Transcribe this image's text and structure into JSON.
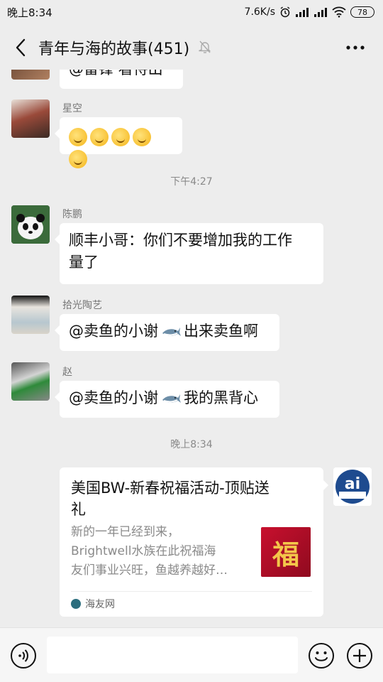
{
  "status": {
    "time": "晚上8:34",
    "speed": "7.6K/s",
    "battery": "78"
  },
  "header": {
    "title": "青年与海的故事(451)"
  },
  "messages": [
    {
      "sender": "",
      "text": "@雷锋  看待出",
      "partial": true
    },
    {
      "sender": "星空",
      "emoji_count": 5
    },
    {
      "timestamp": "下午4:27"
    },
    {
      "sender": "陈鹏",
      "text_line1": "顺丰小哥：你们不要增加我的工作",
      "text_line2": "量了"
    },
    {
      "sender": "拾光陶艺",
      "text_before": "@卖鱼的小谢",
      "text_after": "出来卖鱼啊"
    },
    {
      "sender": "赵",
      "text_before": "@卖鱼的小谢",
      "text_after": "我的黑背心"
    },
    {
      "timestamp": "晚上8:34"
    }
  ],
  "card": {
    "title_line1": "美国BW-新春祝福活动-顶贴送",
    "title_line2": "礼",
    "desc_line1": "新的一年已经到来，",
    "desc_line2": "Brightwell水族在此祝福海",
    "desc_line3": "友们事业兴旺，鱼越养越好…",
    "source": "海友网",
    "thumb_char": "福"
  },
  "colors": {
    "background": "#ededed",
    "bubble": "#ffffff",
    "card_thumb": "#c8102e"
  }
}
